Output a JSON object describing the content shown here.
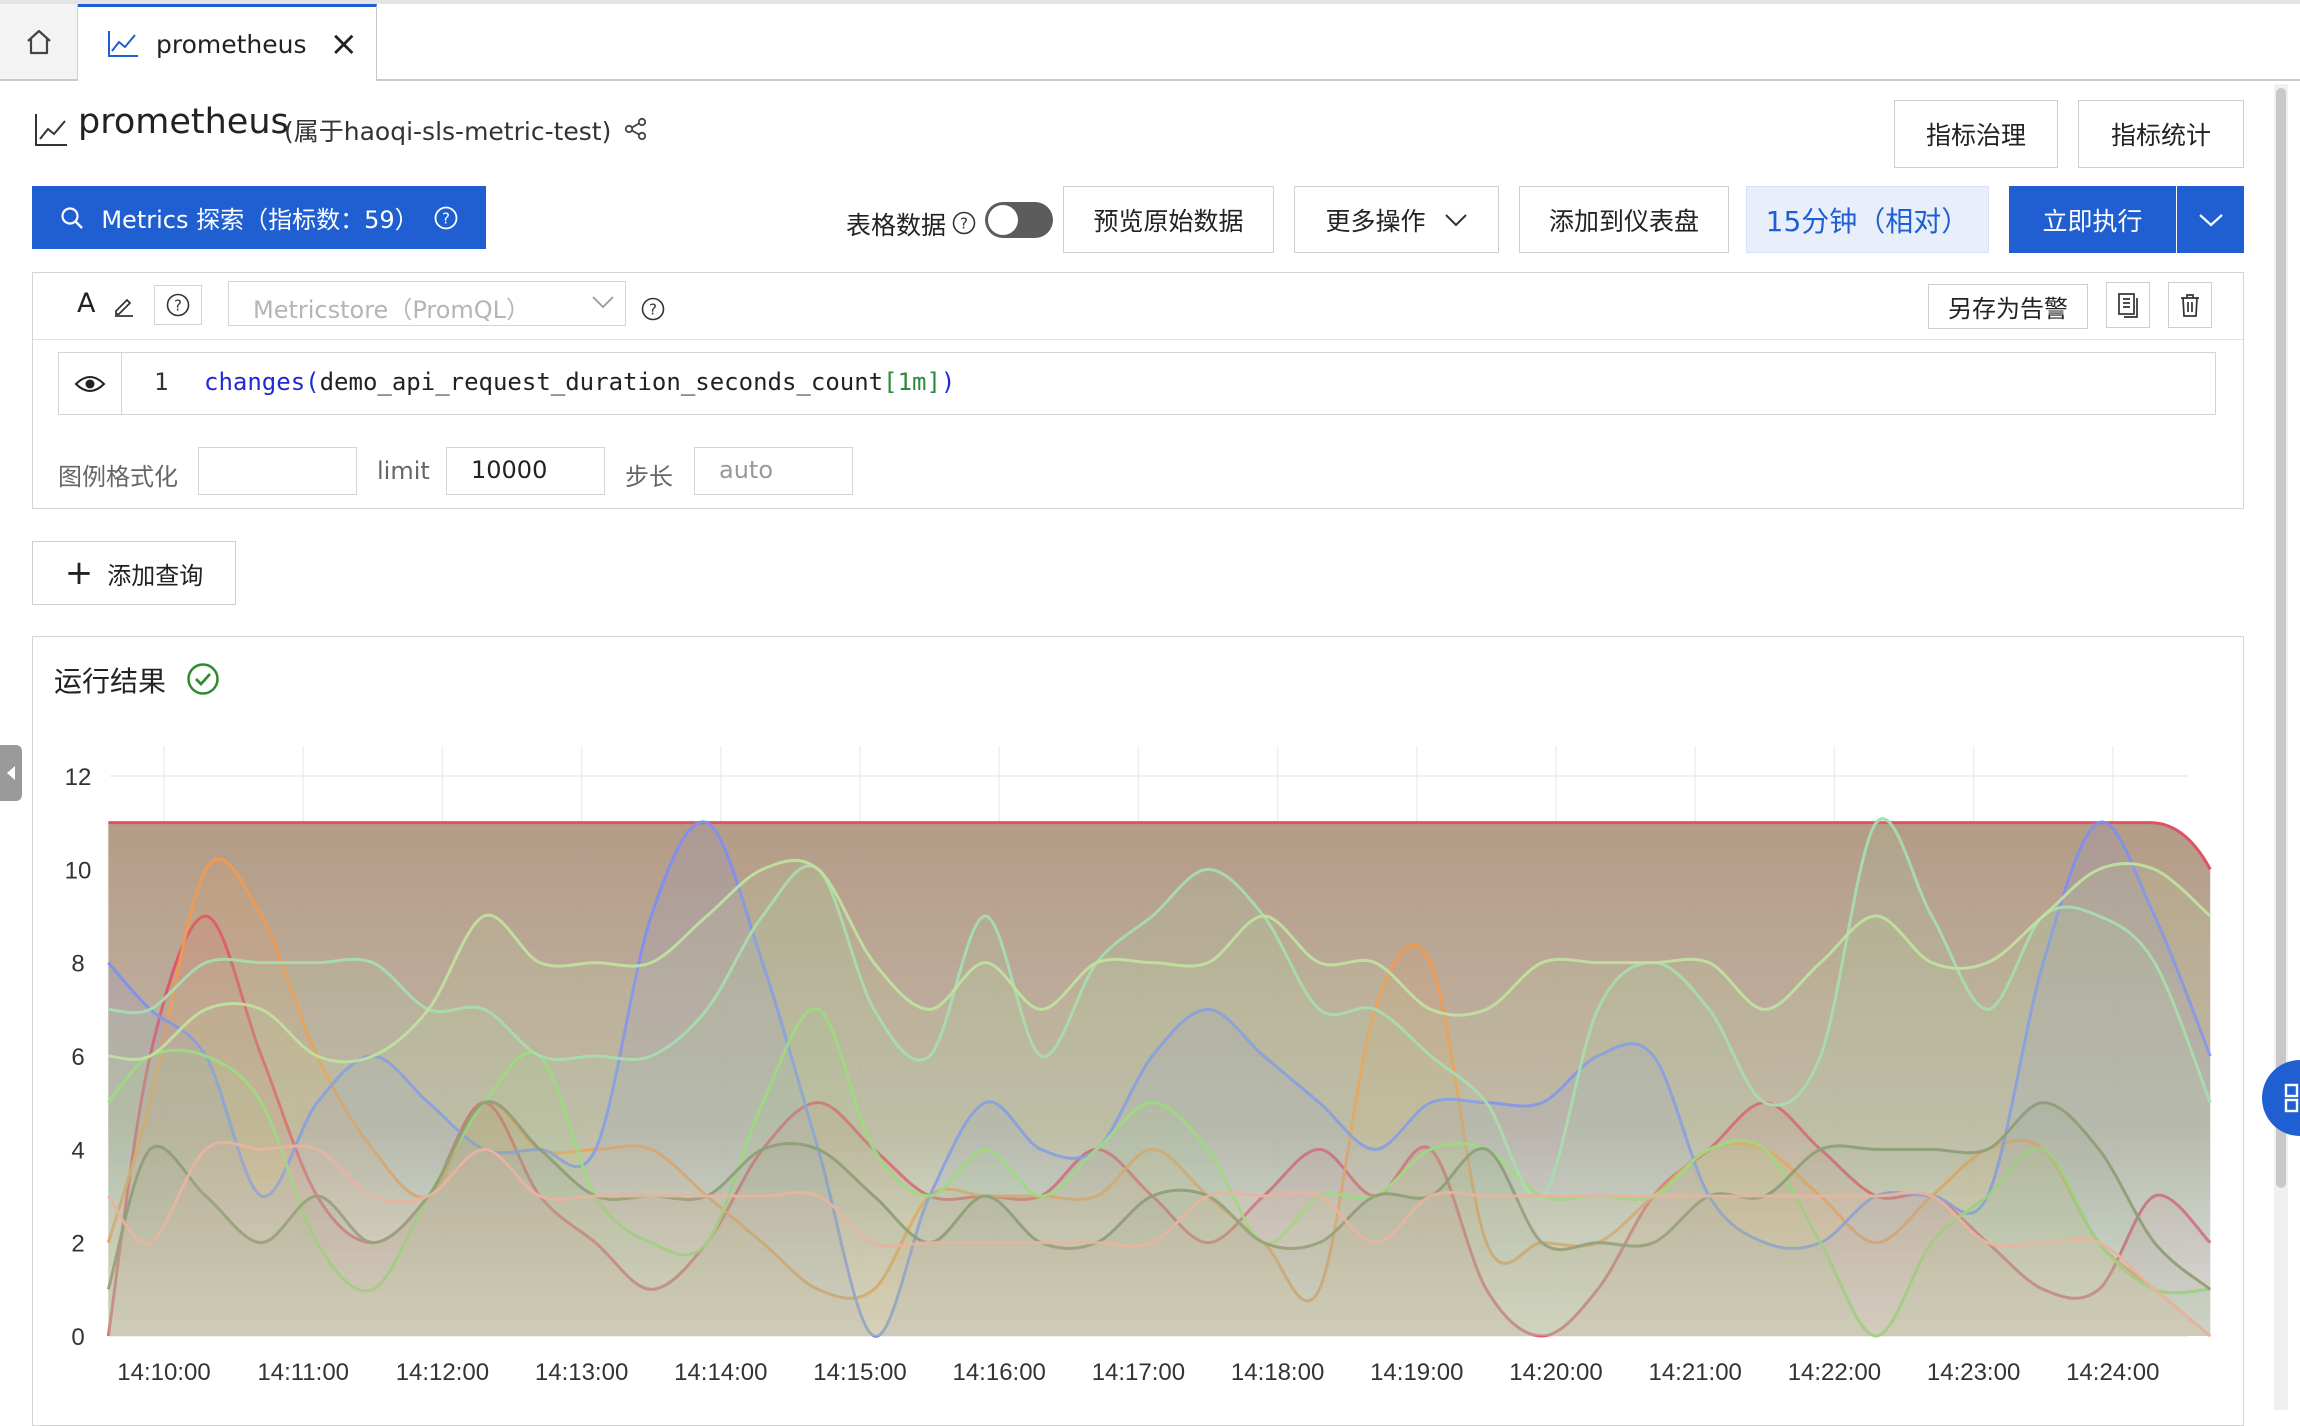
{
  "tabs": {
    "home_icon": "home-icon",
    "active_label": "prometheus",
    "active_icon": "line-chart-icon",
    "close_glyph": "×"
  },
  "header": {
    "title": "prometheus",
    "subtitle": "(属于haoqi-sls-metric-test)",
    "govern_label": "指标治理",
    "stats_label": "指标统计"
  },
  "toolbar": {
    "explore_label": "Metrics 探索（指标数：59）",
    "table_data_label": "表格数据",
    "table_data_toggle": false,
    "preview_label": "预览原始数据",
    "more_label": "更多操作",
    "add_dashboard_label": "添加到仪表盘",
    "time_label": "15分钟（相对）",
    "run_label": "立即执行"
  },
  "query": {
    "mode_label": "A",
    "metricstore_placeholder": "Metricstore（PromQL）",
    "save_alert_label": "另存为告警",
    "line_number": "1",
    "code": {
      "fn": "changes(",
      "metric": "demo_api_request_duration_seconds_count",
      "range": "[1m]",
      "close": ")"
    },
    "legend_format_label": "图例格式化",
    "legend_format_value": "",
    "limit_label": "limit",
    "limit_value": "10000",
    "step_label": "步长",
    "step_value": "auto"
  },
  "add_query_label": "添加查询",
  "result": {
    "title": "运行结果",
    "status": "success"
  },
  "colors": {
    "primary": "#1f5fd1",
    "success": "#2e8b2e",
    "area_fill": "#b89f88",
    "top_series": "#e05268"
  },
  "chart_data": {
    "type": "area",
    "ylim": [
      0,
      12
    ],
    "yticks": [
      0,
      2,
      4,
      6,
      8,
      10,
      12
    ],
    "x": [
      "14:09:36",
      "14:09:54",
      "14:10:18",
      "14:10:42",
      "14:11:06",
      "14:11:30",
      "14:11:54",
      "14:12:18",
      "14:12:42",
      "14:13:06",
      "14:13:30",
      "14:13:54",
      "14:14:18",
      "14:14:42",
      "14:15:06",
      "14:15:30",
      "14:15:54",
      "14:16:18",
      "14:16:42",
      "14:17:06",
      "14:17:30",
      "14:17:54",
      "14:18:18",
      "14:18:42",
      "14:19:06",
      "14:19:30",
      "14:19:54",
      "14:20:18",
      "14:20:42",
      "14:21:06",
      "14:21:30",
      "14:21:54",
      "14:22:18",
      "14:22:42",
      "14:23:06",
      "14:23:30",
      "14:23:54",
      "14:24:18",
      "14:24:42"
    ],
    "xticks": [
      "14:10:00",
      "14:11:00",
      "14:12:00",
      "14:13:00",
      "14:14:00",
      "14:15:00",
      "14:16:00",
      "14:17:00",
      "14:18:00",
      "14:19:00",
      "14:20:00",
      "14:21:00",
      "14:22:00",
      "14:23:00",
      "14:24:00"
    ],
    "series": [
      {
        "color": "#e05268",
        "values": [
          0,
          6,
          9,
          6,
          3,
          2,
          3,
          5,
          3,
          2,
          1,
          2,
          4,
          5,
          4,
          3,
          3,
          3,
          4,
          3,
          2,
          3,
          4,
          3,
          4,
          1,
          0,
          1,
          3,
          4,
          5,
          4,
          3,
          3,
          2,
          1,
          1,
          3,
          2
        ]
      },
      {
        "color": "#f09a52",
        "values": [
          2,
          5,
          10,
          9,
          6,
          4,
          3,
          5,
          4,
          4,
          4,
          3,
          2,
          1,
          1,
          3,
          3,
          3,
          3,
          4,
          3,
          2,
          1,
          7,
          8,
          2,
          2,
          2,
          3,
          4,
          4,
          3,
          2,
          3,
          4,
          4,
          2,
          1,
          0
        ]
      },
      {
        "color": "#7e8ff0",
        "values": [
          8,
          7,
          6,
          3,
          5,
          6,
          5,
          4,
          4,
          4,
          9,
          11,
          8,
          4,
          0,
          3,
          5,
          4,
          4,
          6,
          7,
          6,
          5,
          4,
          5,
          5,
          5,
          6,
          6,
          3,
          2,
          2,
          3,
          3,
          3,
          8,
          11,
          9,
          6
        ]
      },
      {
        "color": "#9ad97a",
        "values": [
          5,
          6,
          6,
          5,
          2,
          1,
          3,
          5,
          6,
          3,
          2,
          2,
          5,
          7,
          4,
          3,
          4,
          3,
          4,
          5,
          4,
          2,
          3,
          3,
          4,
          4,
          3,
          3,
          3,
          4,
          4,
          2,
          0,
          2,
          3,
          4,
          2,
          1,
          1
        ]
      },
      {
        "color": "#a7dcb0",
        "values": [
          7,
          7,
          8,
          8,
          8,
          8,
          7,
          7,
          6,
          6,
          6,
          7,
          9,
          10,
          7,
          6,
          9,
          6,
          8,
          9,
          10,
          9,
          7,
          7,
          6,
          5,
          3,
          7,
          8,
          7,
          5,
          6,
          11,
          9,
          7,
          9,
          9,
          8,
          5
        ]
      },
      {
        "color": "#bfe0a0",
        "values": [
          6,
          6,
          7,
          7,
          6,
          6,
          7,
          9,
          8,
          8,
          8,
          9,
          10,
          10,
          8,
          7,
          8,
          7,
          8,
          8,
          8,
          9,
          8,
          8,
          7,
          7,
          8,
          8,
          8,
          8,
          7,
          8,
          9,
          8,
          8,
          9,
          10,
          10,
          9
        ]
      },
      {
        "color": "#8f9f78",
        "values": [
          1,
          4,
          3,
          2,
          3,
          2,
          3,
          5,
          4,
          3,
          3,
          3,
          4,
          4,
          3,
          2,
          3,
          2,
          2,
          3,
          3,
          2,
          2,
          3,
          3,
          4,
          2,
          2,
          2,
          3,
          3,
          4,
          4,
          4,
          4,
          5,
          4,
          2,
          1
        ]
      },
      {
        "color": "#e6b4a0",
        "values": [
          3,
          2,
          4,
          4,
          4,
          3,
          3,
          4,
          3,
          3,
          3,
          3,
          3,
          3,
          2,
          2,
          2,
          2,
          2,
          2,
          3,
          3,
          3,
          2,
          3,
          3,
          3,
          3,
          3,
          3,
          3,
          3,
          3,
          3,
          2,
          2,
          2,
          1,
          0
        ]
      }
    ],
    "area_top": 11,
    "area_top_end": 10
  }
}
